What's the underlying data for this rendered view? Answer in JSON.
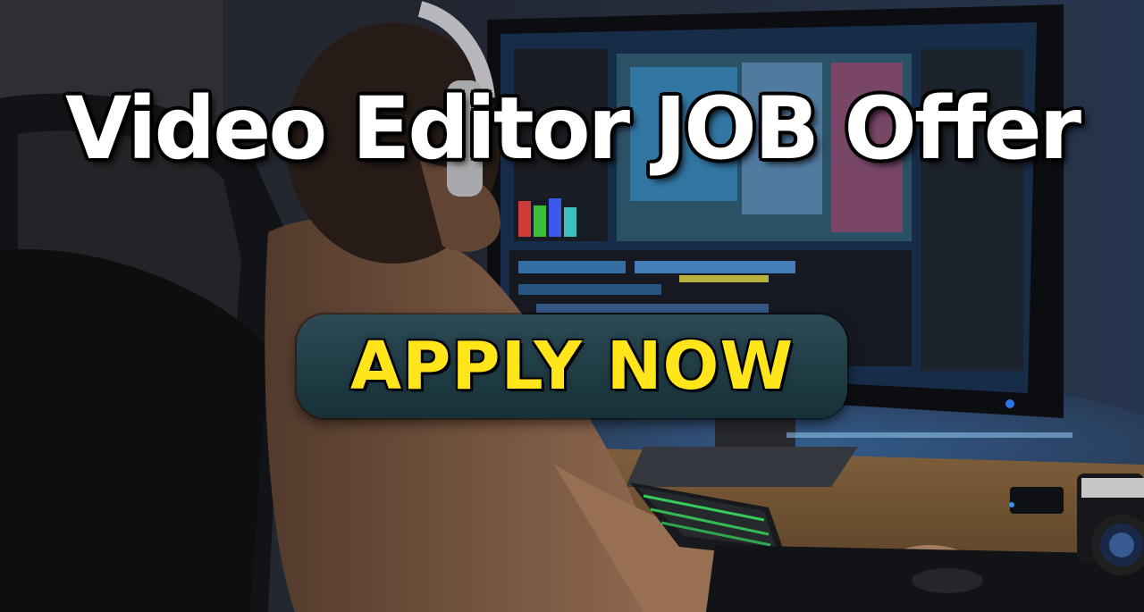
{
  "banner": {
    "headline": "Video Editor JOB Offer",
    "cta_label": "APPLY NOW"
  },
  "colors": {
    "headline": "#ffffff",
    "cta_text": "#ffe51a",
    "cta_background": "#1f3a44",
    "monitor_glow": "#3d8fd6",
    "keyboard_glow": "#3dff6b"
  },
  "scene": {
    "description_icons": [
      "headphones-icon",
      "monitor",
      "keyboard",
      "camera"
    ]
  }
}
